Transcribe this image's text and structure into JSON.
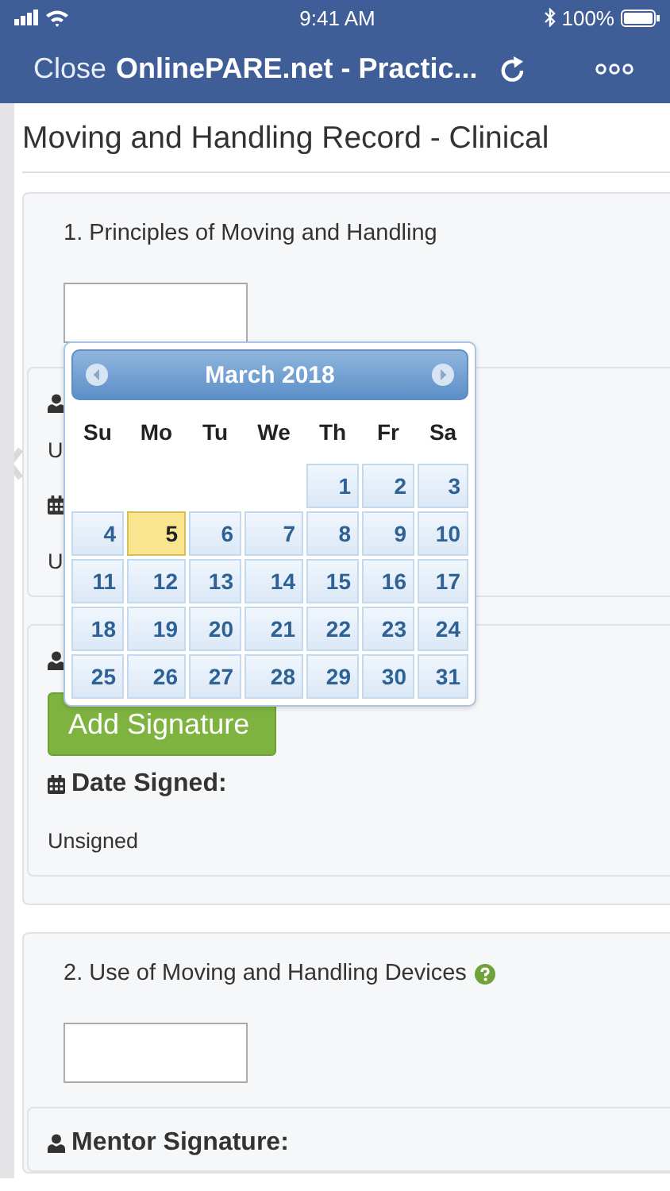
{
  "status_bar": {
    "time": "9:41 AM",
    "battery": "100%"
  },
  "nav": {
    "close": "Close",
    "title": "OnlinePARE.net - Practic..."
  },
  "page_title": "Moving and Handling Record - Clinical",
  "sections": [
    {
      "title": "1. Principles of Moving and Handling",
      "help": false,
      "blocks": [
        {
          "rows": [
            {
              "kind": "signer_label"
            },
            {
              "kind": "value",
              "text": "U"
            },
            {
              "kind": "date_label"
            },
            {
              "kind": "value",
              "text": "U"
            }
          ]
        },
        {
          "rows": [
            {
              "kind": "signer_label"
            },
            {
              "kind": "button",
              "text": "Add Signature"
            },
            {
              "kind": "date_label",
              "text": "Date Signed:"
            },
            {
              "kind": "value",
              "text": "Unsigned"
            }
          ]
        }
      ]
    },
    {
      "title": "2. Use of Moving and Handling Devices",
      "help": true,
      "blocks": [
        {
          "rows": [
            {
              "kind": "signer_label",
              "text": "Mentor Signature:"
            }
          ]
        }
      ]
    }
  ],
  "calendar": {
    "month": "March 2018",
    "weekdays": [
      "Su",
      "Mo",
      "Tu",
      "We",
      "Th",
      "Fr",
      "Sa"
    ],
    "weeks": [
      [
        {
          "kind": "empty"
        },
        {
          "kind": "empty"
        },
        {
          "kind": "empty"
        },
        {
          "kind": "empty"
        },
        {
          "kind": "day",
          "label": "1",
          "selected": false
        },
        {
          "kind": "day",
          "label": "2",
          "selected": false
        },
        {
          "kind": "day",
          "label": "3",
          "selected": false
        }
      ],
      [
        {
          "kind": "day",
          "label": "4",
          "selected": false
        },
        {
          "kind": "day",
          "label": "5",
          "selected": true
        },
        {
          "kind": "day",
          "label": "6",
          "selected": false
        },
        {
          "kind": "day",
          "label": "7",
          "selected": false
        },
        {
          "kind": "day",
          "label": "8",
          "selected": false
        },
        {
          "kind": "day",
          "label": "9",
          "selected": false
        },
        {
          "kind": "day",
          "label": "10",
          "selected": false
        }
      ],
      [
        {
          "kind": "day",
          "label": "11",
          "selected": false
        },
        {
          "kind": "day",
          "label": "12",
          "selected": false
        },
        {
          "kind": "day",
          "label": "13",
          "selected": false
        },
        {
          "kind": "day",
          "label": "14",
          "selected": false
        },
        {
          "kind": "day",
          "label": "15",
          "selected": false
        },
        {
          "kind": "day",
          "label": "16",
          "selected": false
        },
        {
          "kind": "day",
          "label": "17",
          "selected": false
        }
      ],
      [
        {
          "kind": "day",
          "label": "18",
          "selected": false
        },
        {
          "kind": "day",
          "label": "19",
          "selected": false
        },
        {
          "kind": "day",
          "label": "20",
          "selected": false
        },
        {
          "kind": "day",
          "label": "21",
          "selected": false
        },
        {
          "kind": "day",
          "label": "22",
          "selected": false
        },
        {
          "kind": "day",
          "label": "23",
          "selected": false
        },
        {
          "kind": "day",
          "label": "24",
          "selected": false
        }
      ],
      [
        {
          "kind": "day",
          "label": "25",
          "selected": false
        },
        {
          "kind": "day",
          "label": "26",
          "selected": false
        },
        {
          "kind": "day",
          "label": "27",
          "selected": false
        },
        {
          "kind": "day",
          "label": "28",
          "selected": false
        },
        {
          "kind": "day",
          "label": "29",
          "selected": false
        },
        {
          "kind": "day",
          "label": "30",
          "selected": false
        },
        {
          "kind": "day",
          "label": "31",
          "selected": false
        }
      ]
    ]
  }
}
